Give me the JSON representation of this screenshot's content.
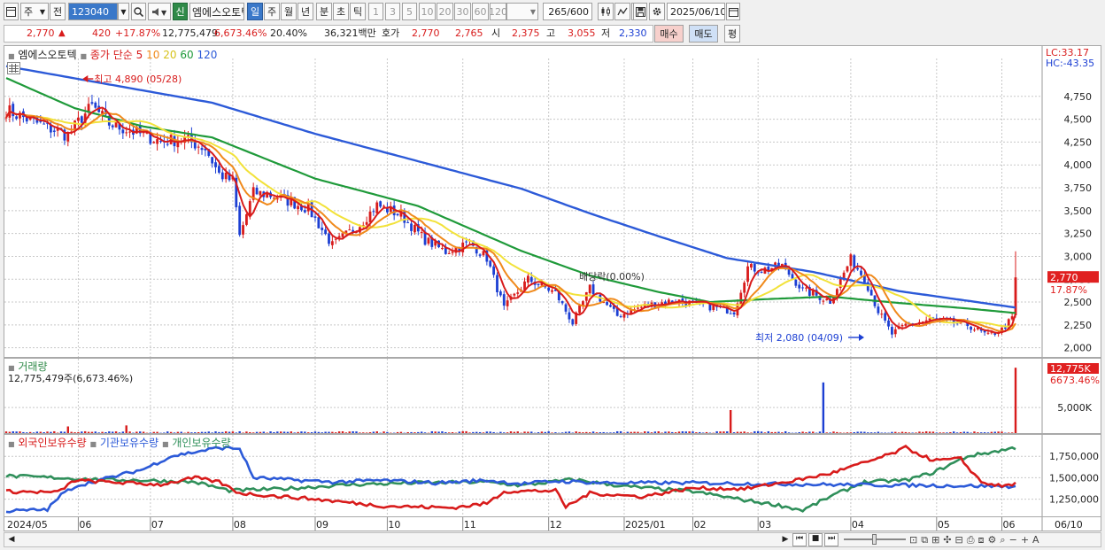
{
  "toolbar": {
    "market_label": "주",
    "prev_label": "전",
    "code": "123040",
    "new_badge": "신",
    "stock_name": "엠에스오토텍",
    "period_tabs": [
      "일",
      "주",
      "월",
      "년",
      "분",
      "초",
      "틱"
    ],
    "interval_buttons": [
      "1",
      "3",
      "5",
      "10",
      "20",
      "30",
      "60",
      "120"
    ],
    "count": "265",
    "count_max": "/600",
    "date": "2025/06/10"
  },
  "quote": {
    "price": "2,770",
    "change": "420",
    "change_pct": "+17.87%",
    "volume": "12,775,479",
    "volume_ratio": "6,673.46%",
    "turnover_pct": "20.40%",
    "amount": "36,321백만",
    "hoga_label": "호가",
    "bid": "2,770",
    "ask": "2,765",
    "open_label": "시",
    "open": "2,375",
    "high_label": "고",
    "high": "3,055",
    "low_label": "저",
    "low": "2,330",
    "buy_label": "매수",
    "sell_label": "매도",
    "eval_label": "평"
  },
  "price_legend": {
    "name": "엠에스오토텍",
    "type": "종가 단순",
    "ma": [
      {
        "label": "5",
        "color": "#d81b1b"
      },
      {
        "label": "10",
        "color": "#f08a1c"
      },
      {
        "label": "20",
        "color": "#f2e23a"
      },
      {
        "label": "60",
        "color": "#1f9a3a"
      },
      {
        "label": "120",
        "color": "#2c5ad8"
      }
    ],
    "lc": "LC:33.17",
    "hc": "HC:-43.35",
    "high_note": "최고 4,890 (05/28)",
    "low_note": "최저 2,080 (04/09)",
    "dividend_note": "배당락(0.00%)",
    "last_price_tag": "2,770",
    "last_pct_tag": "17.87%"
  },
  "volume_legend": {
    "title": "거래량",
    "value": "12,775,479주(6,673.46%)",
    "tag_value": "12,775K",
    "tag_pct": "6673.46%",
    "axis_label": "5,000K"
  },
  "flow_legend": {
    "foreign": "외국인보유수량",
    "inst": "기관보유수량",
    "indiv": "개인보유수량",
    "ticks": [
      "1,750,000",
      "1,500,000",
      "1,250,000"
    ]
  },
  "x_axis_labels": [
    "2024/05",
    "06",
    "07",
    "08",
    "09",
    "10",
    "11",
    "12",
    "2025/01",
    "02",
    "03",
    "04",
    "05",
    "06",
    "06/10"
  ],
  "colors": {
    "up": "#d81b1b",
    "down": "#1c3fd3",
    "ma5": "#d81b1b",
    "ma10": "#f08a1c",
    "ma20": "#f2e23a",
    "ma60": "#1f9a3a",
    "ma120": "#2c5ad8",
    "foreign": "#d81b1b",
    "inst": "#2c5ad8",
    "indiv": "#2f8f5a"
  },
  "chart_data": {
    "type": "candlestick",
    "y_ticks": [
      2000,
      2250,
      2500,
      2750,
      3000,
      3250,
      3500,
      3750,
      4000,
      4250,
      4500,
      4750
    ],
    "ylim": [
      1900,
      5300
    ],
    "months": [
      "2024/05",
      "06",
      "07",
      "08",
      "09",
      "10",
      "11",
      "12",
      "2025/01",
      "02",
      "03",
      "04",
      "05",
      "06"
    ],
    "close_path": [
      [
        0,
        4600
      ],
      [
        8,
        4470
      ],
      [
        18,
        4320
      ],
      [
        22,
        4520
      ],
      [
        25,
        4640
      ],
      [
        30,
        4450
      ],
      [
        38,
        4350
      ],
      [
        45,
        4260
      ],
      [
        52,
        4280
      ],
      [
        58,
        4180
      ],
      [
        62,
        3900
      ],
      [
        66,
        3820
      ],
      [
        68,
        3220
      ],
      [
        72,
        3700
      ],
      [
        78,
        3660
      ],
      [
        88,
        3520
      ],
      [
        95,
        3120
      ],
      [
        103,
        3350
      ],
      [
        108,
        3560
      ],
      [
        115,
        3450
      ],
      [
        122,
        3180
      ],
      [
        128,
        3050
      ],
      [
        135,
        3150
      ],
      [
        140,
        2980
      ],
      [
        145,
        2430
      ],
      [
        152,
        2750
      ],
      [
        160,
        2600
      ],
      [
        165,
        2270
      ],
      [
        170,
        2650
      ],
      [
        178,
        2350
      ],
      [
        186,
        2460
      ],
      [
        195,
        2520
      ],
      [
        205,
        2450
      ],
      [
        212,
        2400
      ],
      [
        216,
        2880
      ],
      [
        220,
        2850
      ],
      [
        226,
        2900
      ],
      [
        232,
        2630
      ],
      [
        240,
        2510
      ],
      [
        246,
        2970
      ],
      [
        250,
        2760
      ],
      [
        254,
        2400
      ],
      [
        258,
        2150
      ],
      [
        262,
        2250
      ],
      [
        270,
        2310
      ],
      [
        280,
        2250
      ],
      [
        286,
        2130
      ],
      [
        290,
        2200
      ],
      [
        293,
        2320
      ],
      [
        294,
        2770
      ]
    ],
    "ma_paths": {
      "ma60": [
        [
          0,
          4950
        ],
        [
          20,
          4620
        ],
        [
          40,
          4420
        ],
        [
          60,
          4300
        ],
        [
          90,
          3850
        ],
        [
          120,
          3550
        ],
        [
          150,
          3060
        ],
        [
          170,
          2790
        ],
        [
          190,
          2610
        ],
        [
          205,
          2500
        ],
        [
          220,
          2530
        ],
        [
          240,
          2560
        ],
        [
          260,
          2490
        ],
        [
          280,
          2430
        ],
        [
          294,
          2380
        ]
      ],
      "ma120": [
        [
          0,
          5080
        ],
        [
          30,
          4880
        ],
        [
          60,
          4680
        ],
        [
          90,
          4340
        ],
        [
          120,
          4040
        ],
        [
          150,
          3740
        ],
        [
          170,
          3470
        ],
        [
          190,
          3220
        ],
        [
          210,
          2980
        ],
        [
          235,
          2830
        ],
        [
          260,
          2620
        ],
        [
          294,
          2440
        ]
      ]
    },
    "volume_spikes": [
      [
        18,
        1300
      ],
      [
        35,
        1500
      ],
      [
        211,
        4500
      ],
      [
        238,
        9900
      ],
      [
        294,
        12775
      ]
    ],
    "volume_max": 13500,
    "flow_ylim": [
      1050000,
      2000000
    ],
    "flow_series": {
      "foreign": [
        [
          0,
          1340000
        ],
        [
          15,
          1330000
        ],
        [
          20,
          1470000
        ],
        [
          45,
          1420000
        ],
        [
          55,
          1500000
        ],
        [
          62,
          1450000
        ],
        [
          68,
          1320000
        ],
        [
          90,
          1250000
        ],
        [
          110,
          1170000
        ],
        [
          130,
          1150000
        ],
        [
          140,
          1200000
        ],
        [
          145,
          1340000
        ],
        [
          160,
          1350000
        ],
        [
          163,
          1160000
        ],
        [
          170,
          1320000
        ],
        [
          185,
          1280000
        ],
        [
          200,
          1380000
        ],
        [
          215,
          1370000
        ],
        [
          230,
          1470000
        ],
        [
          240,
          1550000
        ],
        [
          248,
          1650000
        ],
        [
          252,
          1700000
        ],
        [
          258,
          1780000
        ],
        [
          262,
          1850000
        ],
        [
          270,
          1700000
        ],
        [
          278,
          1720000
        ],
        [
          284,
          1450000
        ],
        [
          290,
          1400000
        ],
        [
          294,
          1430000
        ]
      ],
      "inst": [
        [
          0,
          1110000
        ],
        [
          12,
          1130000
        ],
        [
          16,
          1300000
        ],
        [
          20,
          1400000
        ],
        [
          30,
          1500000
        ],
        [
          40,
          1600000
        ],
        [
          48,
          1750000
        ],
        [
          55,
          1800000
        ],
        [
          62,
          1850000
        ],
        [
          68,
          1840000
        ],
        [
          72,
          1500000
        ],
        [
          95,
          1450000
        ],
        [
          110,
          1470000
        ],
        [
          125,
          1440000
        ],
        [
          140,
          1470000
        ],
        [
          150,
          1430000
        ],
        [
          160,
          1460000
        ],
        [
          175,
          1440000
        ],
        [
          200,
          1440000
        ],
        [
          240,
          1420000
        ],
        [
          270,
          1410000
        ],
        [
          294,
          1400000
        ]
      ],
      "indiv": [
        [
          0,
          1520000
        ],
        [
          15,
          1500000
        ],
        [
          25,
          1480000
        ],
        [
          40,
          1470000
        ],
        [
          55,
          1450000
        ],
        [
          65,
          1350000
        ],
        [
          80,
          1370000
        ],
        [
          100,
          1420000
        ],
        [
          120,
          1440000
        ],
        [
          140,
          1450000
        ],
        [
          150,
          1410000
        ],
        [
          165,
          1480000
        ],
        [
          180,
          1400000
        ],
        [
          200,
          1340000
        ],
        [
          215,
          1240000
        ],
        [
          225,
          1180000
        ],
        [
          232,
          1120000
        ],
        [
          240,
          1280000
        ],
        [
          250,
          1450000
        ],
        [
          262,
          1470000
        ],
        [
          270,
          1560000
        ],
        [
          280,
          1750000
        ],
        [
          290,
          1820000
        ],
        [
          294,
          1850000
        ]
      ]
    },
    "n_bars": 295
  }
}
